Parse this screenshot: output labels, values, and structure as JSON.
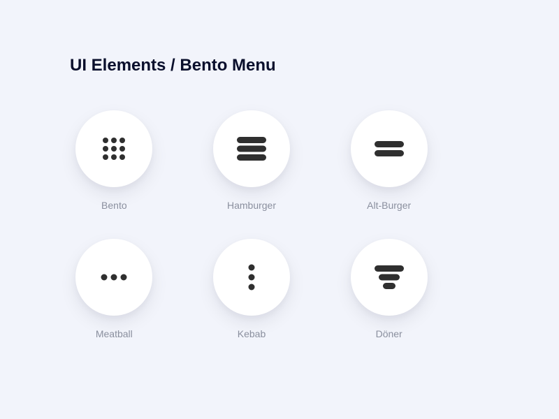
{
  "page": {
    "title": "UI Elements / Bento Menu"
  },
  "icons": [
    {
      "name": "bento",
      "label": "Bento"
    },
    {
      "name": "hamburger",
      "label": "Hamburger"
    },
    {
      "name": "alt-burger",
      "label": "Alt-Burger"
    },
    {
      "name": "meatball",
      "label": "Meatball"
    },
    {
      "name": "kebab",
      "label": "Kebab"
    },
    {
      "name": "doner",
      "label": "Döner"
    }
  ],
  "colors": {
    "background": "#f2f4fb",
    "circle": "#ffffff",
    "iconFill": "#2f2f2f",
    "title": "#0a0f2c",
    "label": "#8a8f9e"
  }
}
